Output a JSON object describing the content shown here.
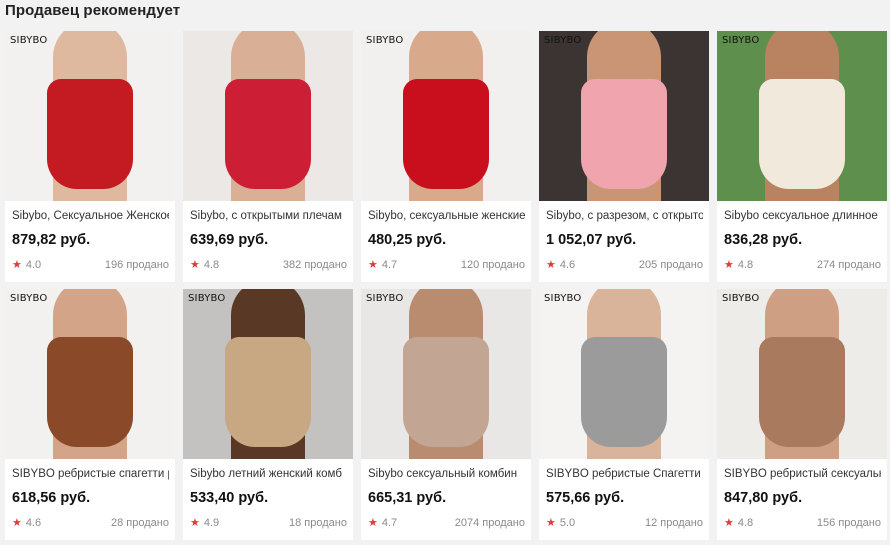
{
  "section": {
    "title": "Продавец рекомендует"
  },
  "colors": {
    "star": "#e03a3a",
    "card_bg": "#ffffff",
    "page_bg": "#f2f2f2"
  },
  "icons": {
    "rating": "star-icon"
  },
  "products": [
    {
      "brand": "SIBYBO",
      "name": "Sibybo, Сексуальное Женское",
      "price": "879,82 руб.",
      "rating": "4.0",
      "sold": "196 продано",
      "palette": [
        "#f3f1ef",
        "#c41a22",
        "#dfb8a0"
      ]
    },
    {
      "brand": "",
      "name": "Sibybo, с открытыми плечам",
      "price": "639,69 руб.",
      "rating": "4.8",
      "sold": "382 продано",
      "palette": [
        "#ece8e6",
        "#cc1f35",
        "#d9b096"
      ]
    },
    {
      "brand": "SIBYBO",
      "name": "Sibybo, сексуальные женские",
      "price": "480,25 руб.",
      "rating": "4.7",
      "sold": "120 продано",
      "palette": [
        "#f2f0ee",
        "#c90f1d",
        "#d8a98b"
      ]
    },
    {
      "brand": "SIBYBO",
      "name": "Sibybo, с разрезом, с открыто",
      "price": "1 052,07 руб.",
      "rating": "4.6",
      "sold": "205 продано",
      "palette": [
        "#3c3432",
        "#f0a4ad",
        "#c99574"
      ]
    },
    {
      "brand": "SIBYBO",
      "name": "Sibybo сексуальное длинное",
      "price": "836,28 руб.",
      "rating": "4.8",
      "sold": "274 продано",
      "palette": [
        "#5e8f4c",
        "#f2e9dd",
        "#b98260"
      ]
    },
    {
      "brand": "SIBYBO",
      "name": "SIBYBO ребристые спагетти р",
      "price": "618,56 руб.",
      "rating": "4.6",
      "sold": "28 продано",
      "palette": [
        "#f3f1ef",
        "#8a4a2a",
        "#d3a488"
      ]
    },
    {
      "brand": "SIBYBO",
      "name": "Sibybo летний женский комб",
      "price": "533,40 руб.",
      "rating": "4.9",
      "sold": "18 продано",
      "palette": [
        "#c4c2c0",
        "#c7a883",
        "#5a3826"
      ]
    },
    {
      "brand": "SIBYBO",
      "name": "Sibybo сексуальный комбин",
      "price": "665,31 руб.",
      "rating": "4.7",
      "sold": "2074 продано",
      "palette": [
        "#e9e7e5",
        "#c3a594",
        "#b98b6f"
      ]
    },
    {
      "brand": "SIBYBO",
      "name": "SIBYBO ребристые Спагетти",
      "price": "575,66 руб.",
      "rating": "5.0",
      "sold": "12 продано",
      "palette": [
        "#f4f3f2",
        "#9b9b9b",
        "#d9b49a"
      ]
    },
    {
      "brand": "SIBYBO",
      "name": "SIBYBO ребристый сексуальн",
      "price": "847,80 руб.",
      "rating": "4.8",
      "sold": "156 продано",
      "palette": [
        "#eeece9",
        "#a97a5e",
        "#cf9f83"
      ]
    }
  ]
}
